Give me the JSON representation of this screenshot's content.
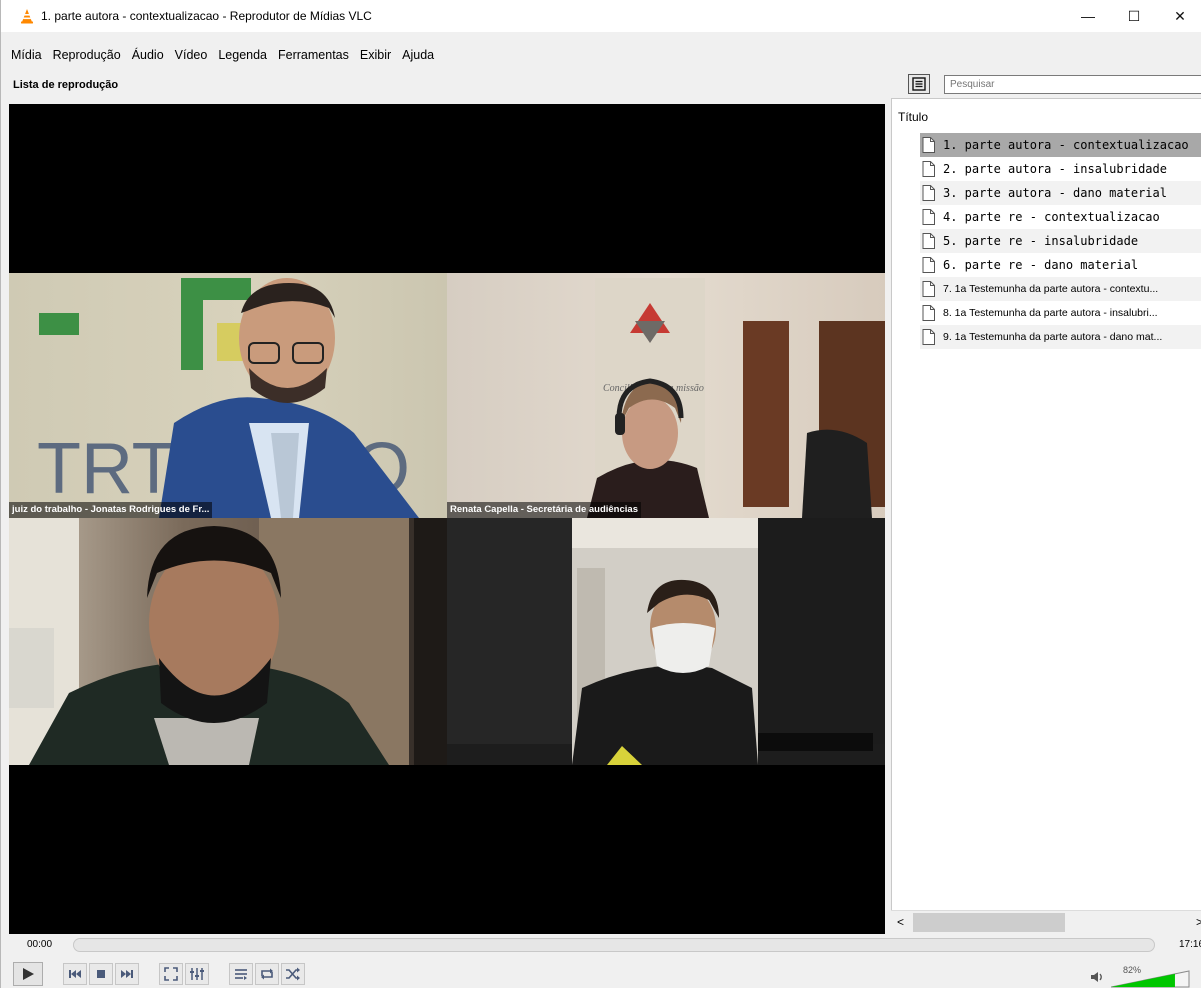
{
  "window": {
    "title": "1. parte autora - contextualizacao - Reprodutor de Mídias VLC",
    "minimize": "—",
    "maximize": "☐",
    "close": "✕"
  },
  "menu": [
    "Mídia",
    "Reprodução",
    "Áudio",
    "Vídeo",
    "Legenda",
    "Ferramentas",
    "Exibir",
    "Ajuda"
  ],
  "playlist_bar": {
    "label": "Lista de reprodução",
    "search_placeholder": "Pesquisar"
  },
  "video": {
    "participants": [
      {
        "label": "juiz do trabalho - Jonatas Rodrigues de Fr..."
      },
      {
        "label": "Renata Capella - Secretária de audiências"
      },
      {
        "label": ""
      },
      {
        "label": ""
      }
    ],
    "background_text": {
      "logo": "TRT-",
      "banner": "Conciliar é nossa missão"
    }
  },
  "playlist": {
    "column_header": "Título",
    "items": [
      {
        "label": "1. parte autora - contextualizacao",
        "selected": true
      },
      {
        "label": "2. parte autora - insalubridade"
      },
      {
        "label": "3. parte autora - dano material"
      },
      {
        "label": "4. parte re - contextualizacao"
      },
      {
        "label": "5. parte re - insalubridade"
      },
      {
        "label": "6. parte re - dano material"
      },
      {
        "label": "7. 1a Testemunha da parte autora - contextu..."
      },
      {
        "label": "8. 1a Testemunha da parte autora - insalubri..."
      },
      {
        "label": "9. 1a Testemunha da parte autora - dano mat..."
      }
    ],
    "scroll_left": "<",
    "scroll_right": ">"
  },
  "playback": {
    "current_time": "00:00",
    "total_time": "17:16",
    "progress": 0,
    "volume_label": "82%",
    "volume": 0.82
  },
  "colors": {
    "accent": "#00c600",
    "selected_row": "#a8a8a8",
    "vlc_orange": "#ff8800"
  }
}
